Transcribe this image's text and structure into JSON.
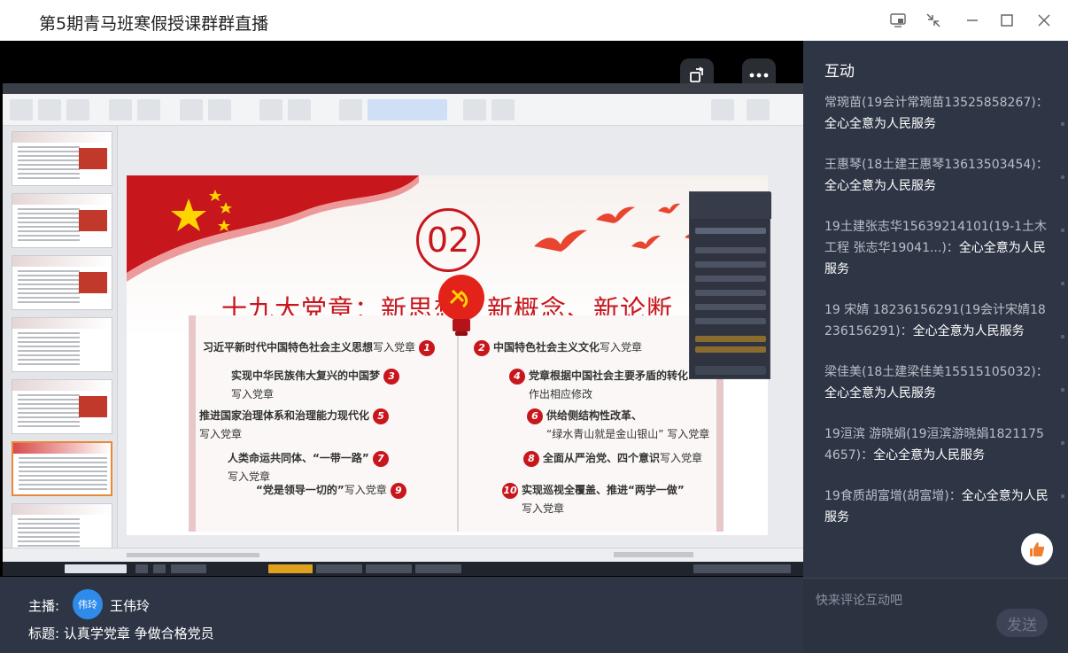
{
  "window": {
    "title": "第5期青马班寒假授课群群直播"
  },
  "slide": {
    "number": "02",
    "heading": "十九大党章：新思想、新概念、新论断",
    "items": [
      {
        "text": "习近平新时代中国特色社会主义思想",
        "suffix": "写入党章",
        "num": "1",
        "sub": ""
      },
      {
        "text": "中国特色社会主义文化",
        "suffix": "写入党章",
        "num": "2",
        "sub": ""
      },
      {
        "text": "实现中华民族伟大复兴的中国梦",
        "suffix": "",
        "num": "3",
        "sub": "写入党章"
      },
      {
        "text": "党章根据中国社会主要矛盾的转化",
        "suffix": "",
        "num": "4",
        "sub": "作出相应修改"
      },
      {
        "text": "推进国家治理体系和治理能力现代化",
        "suffix": "",
        "num": "5",
        "sub": "写入党章"
      },
      {
        "text": "供给侧结构性改革、",
        "suffix": "",
        "num": "6",
        "sub": "“绿水青山就是金山银山” 写入党章"
      },
      {
        "text": "人类命运共同体、“一带一路”",
        "suffix": "",
        "num": "7",
        "sub": "写入党章"
      },
      {
        "text": "全面从严治党、四个意识",
        "suffix": "写入党章",
        "num": "8",
        "sub": ""
      },
      {
        "text": "“党是领导一切的”",
        "suffix": "写入党章",
        "num": "9",
        "sub": ""
      },
      {
        "text": "实现巡视全覆盖、推进“两学一做”",
        "suffix": "",
        "num": "10",
        "sub": "写入党章"
      }
    ]
  },
  "side": {
    "title": "互动",
    "comments": [
      {
        "name": "常琬苗(19会计常琬苗13525858267)：",
        "text": "全心全意为人民服务"
      },
      {
        "name": "王惠琴(18土建王惠琴13613503454)：",
        "text": "全心全意为人民服务"
      },
      {
        "name": "19土建张志华15639214101(19-1土木工程 张志华19041...)：",
        "text": "全心全意为人民服务"
      },
      {
        "name": "19 宋婧 18236156291(19会计宋婧18236156291)：",
        "text": "全心全意为人民服务"
      },
      {
        "name": "梁佳美(18土建梁佳美15515105032)：",
        "text": "全心全意为人民服务"
      },
      {
        "name": "19洹滨 游晓娟(19洹滨游晓娟18211754657)：",
        "text": "全心全意为人民服务"
      },
      {
        "name": "19食质胡富增(胡富增)：",
        "text": "全心全意为人民服务"
      }
    ],
    "input_placeholder": "快来评论互动吧",
    "send_label": "发送"
  },
  "info": {
    "host_label": "主播:",
    "host_avatar_text": "伟玲",
    "host_name": "王伟玲",
    "topic": "标题: 认真学党章 争做合格党员"
  },
  "colors": {
    "accent_red": "#c8161d",
    "panel_bg": "#2e3645",
    "avatar_blue": "#2f8bea"
  },
  "icons": [
    "screen-share-icon",
    "shrink-icon",
    "minimize-icon",
    "maximize-icon",
    "close-icon",
    "rotate-icon",
    "more-icon",
    "thumb-up-icon"
  ]
}
